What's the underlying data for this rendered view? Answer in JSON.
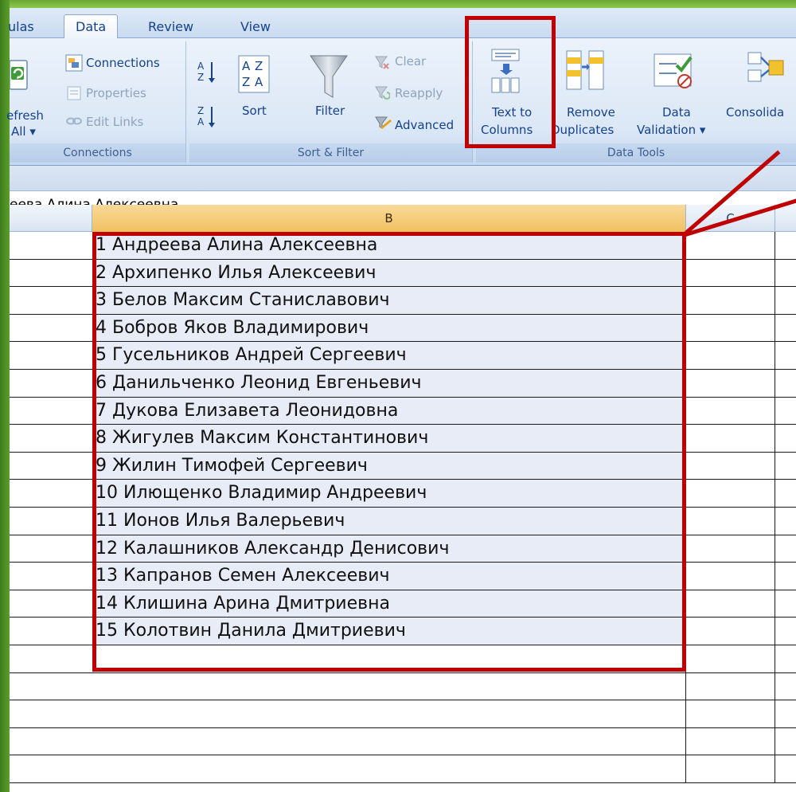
{
  "ribbon_tabs": [
    "ulas",
    "Data",
    "Review",
    "View"
  ],
  "connections_group": {
    "refresh_label_1": "efresh",
    "refresh_label_2": "All ▾",
    "connections": "Connections",
    "properties": "Properties",
    "edit_links": "Edit Links",
    "label": "Connections"
  },
  "sort_filter_group": {
    "sort": "Sort",
    "filter": "Filter",
    "clear": "Clear",
    "reapply": "Reapply",
    "advanced": "Advanced",
    "label": "Sort & Filter"
  },
  "data_tools_group": {
    "text_to_columns_1": "Text to",
    "text_to_columns_2": "Columns",
    "remove_duplicates_1": "Remove",
    "remove_duplicates_2": "Duplicates",
    "data_validation_1": "Data",
    "data_validation_2": "Validation ▾",
    "consolidate": "Consolida",
    "label": "Data Tools"
  },
  "formula_bar": {
    "content": "еева Алина Алексеевна"
  },
  "column_headers": [
    "B",
    "C"
  ],
  "rows": [
    "1 Андреева Алина Алексеевна",
    "2 Архипенко Илья Алексеевич",
    "3 Белов Максим Станиславович",
    "4 Бобров Яков Владимирович",
    "5 Гусельников Андрей Сергеевич",
    "6 Данильченко Леонид Евгеньевич",
    "7 Дукова Елизавета Леонидовна",
    "8 Жигулев Максим Константинович",
    "9 Жилин Тимофей Сергеевич",
    "10 Илющенко Владимир Андреевич",
    "11 Ионов Илья Валерьевич",
    "12 Калашников Александр Денисович",
    "13 Капранов Семен Алексеевич",
    "14 Клишина Арина Дмитриевна",
    "15 Колотвин Данила Дмитриевич"
  ],
  "colors": {
    "highlight": "#c00000",
    "ribbon_text": "#15428b",
    "selected_header": "#f1c15f"
  }
}
